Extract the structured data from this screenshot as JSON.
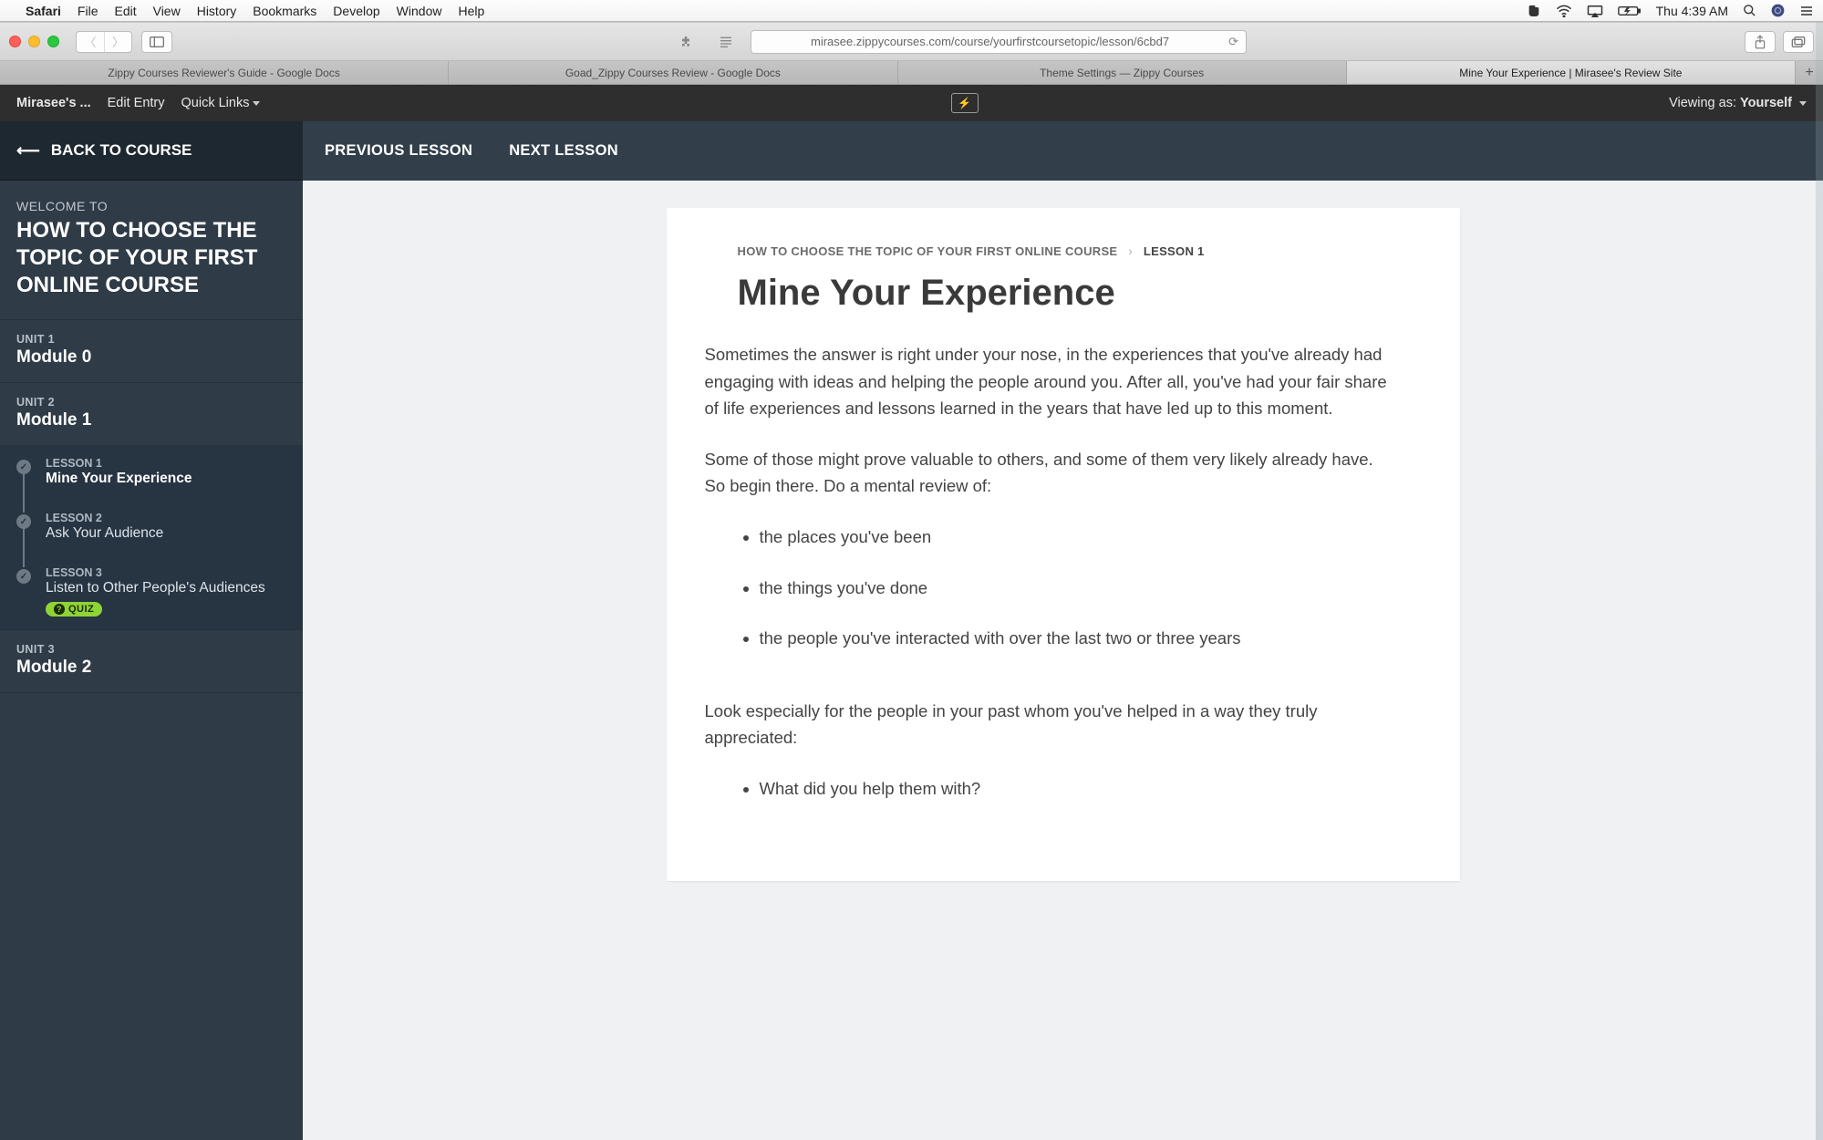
{
  "mac": {
    "app": "Safari",
    "menu": [
      "File",
      "Edit",
      "View",
      "History",
      "Bookmarks",
      "Develop",
      "Window",
      "Help"
    ],
    "clock_day": "Thu",
    "clock_time": "4:39 AM"
  },
  "safari": {
    "url": "mirasee.zippycourses.com/course/yourfirstcoursetopic/lesson/6cbd7",
    "tabs": [
      "Zippy Courses Reviewer's Guide - Google Docs",
      "Goad_Zippy Courses Review - Google Docs",
      "Theme Settings — Zippy Courses",
      "Mine Your Experience | Mirasee's Review Site"
    ],
    "active_tab_index": 3
  },
  "adminbar": {
    "site": "Mirasee's ...",
    "edit": "Edit Entry",
    "quicklinks": "Quick Links",
    "viewing_label": "Viewing as:",
    "viewing_value": "Yourself"
  },
  "sidebar": {
    "back": "BACK TO COURSE",
    "welcome_pre": "WELCOME TO",
    "course_title": "HOW TO CHOOSE THE TOPIC OF YOUR FIRST ONLINE COURSE",
    "units": [
      {
        "label": "UNIT 1",
        "title": "Module 0",
        "lessons": []
      },
      {
        "label": "UNIT 2",
        "title": "Module 1",
        "lessons": [
          {
            "label": "LESSON 1",
            "title": "Mine Your Experience",
            "active": true,
            "quiz": false
          },
          {
            "label": "LESSON 2",
            "title": "Ask Your Audience",
            "active": false,
            "quiz": false
          },
          {
            "label": "LESSON 3",
            "title": "Listen to Other People's Audiences",
            "active": false,
            "quiz": true
          }
        ]
      },
      {
        "label": "UNIT 3",
        "title": "Module 2",
        "lessons": []
      }
    ],
    "quiz_label": "QUIZ"
  },
  "lessonnav": {
    "prev": "PREVIOUS LESSON",
    "next": "NEXT LESSON"
  },
  "content": {
    "breadcrumb_course": "HOW TO CHOOSE THE TOPIC OF YOUR FIRST ONLINE COURSE",
    "breadcrumb_lesson": "LESSON 1",
    "title": "Mine Your Experience",
    "p1": "Sometimes the answer is right under your nose, in the experiences that you've already had engaging with ideas and helping the people around you. After all, you've had your fair share of life experiences and lessons learned in the years that have led up to this moment.",
    "p2": "Some of those might prove valuable to others, and some of them very likely already have. So begin there. Do a mental review of:",
    "bullets1": [
      "the places you've been",
      "the things you've done",
      "the people you've interacted with over the last two or three years"
    ],
    "p3": "Look especially for the people in your past whom you've helped in a way they truly appreciated:",
    "bullets2": [
      "What did you help them with?"
    ]
  }
}
